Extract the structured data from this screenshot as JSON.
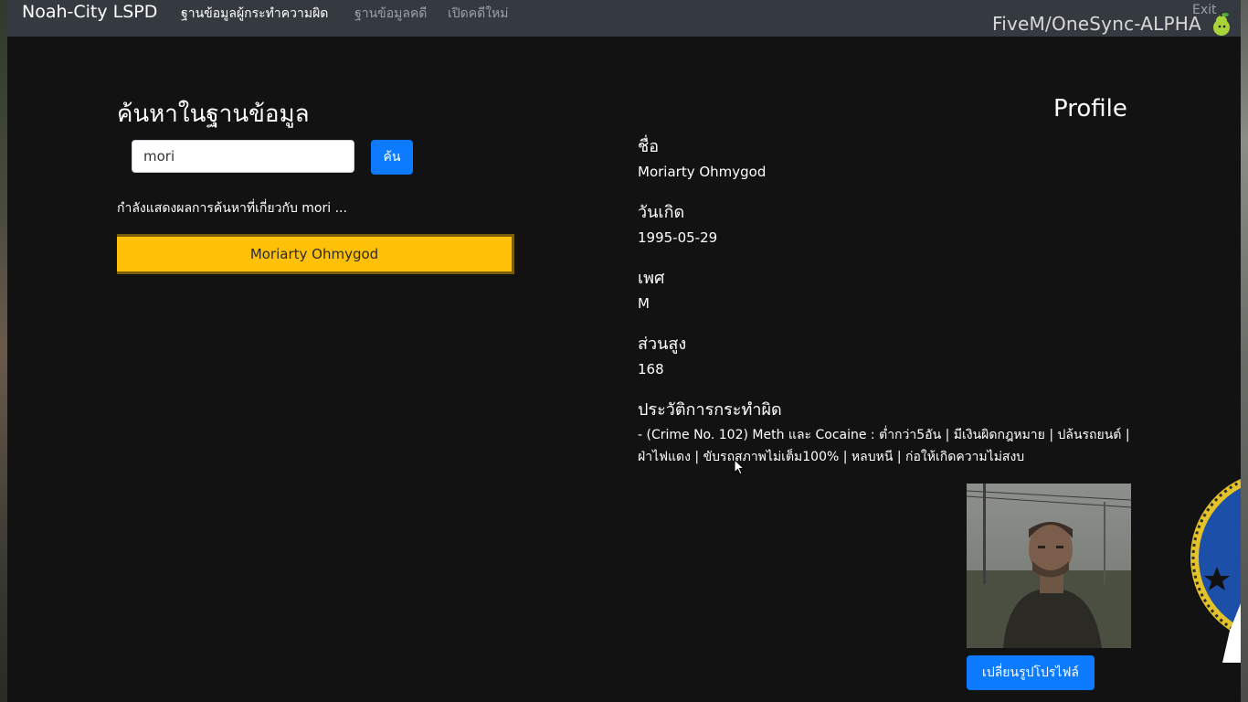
{
  "navbar": {
    "brand": "Noah-City LSPD",
    "links": [
      {
        "label": "ฐานข้อมูลผู้กระทำความผิด",
        "active": true
      },
      {
        "label": "ฐานข้อมูลคดี",
        "active": false
      },
      {
        "label": "เปิดคดีใหม่",
        "active": false
      }
    ],
    "exit_label": "Exit"
  },
  "overlay": {
    "server_label": "FiveM/OneSync-ALPHA"
  },
  "search": {
    "title": "ค้นหาในฐานข้อมูล",
    "query": "mori",
    "button_label": "ค้น",
    "result_caption": "กำลังแสดงผลการค้นหาที่เกี่ยวกับ mori ...",
    "results": [
      "Moriarty Ohmygod"
    ]
  },
  "profile": {
    "title": "Profile",
    "name_label": "ชื่อ",
    "name": "Moriarty Ohmygod",
    "dob_label": "วันเกิด",
    "dob": "1995-05-29",
    "sex_label": "เพศ",
    "sex": "M",
    "height_label": "ส่วนสูง",
    "height": "168",
    "record_label": "ประวัติการกระทำผิด",
    "record": "- (Crime No. 102) Meth และ Cocaine : ต่ำกว่า5อัน | มีเงินผิดกฎหมาย | ปล้นรถยนต์ | ฝ่าไฟแดง | ขับรถสภาพไม่เต็ม100% | หลบหนี | ก่อให้เกิดความไม่สงบ",
    "change_photo_label": "เปลี่ยนรูปโปรไฟล์"
  },
  "colors": {
    "background": "#121212",
    "navbar": "#353a40",
    "primary": "#0d7bff",
    "result_highlight": "#ffc107"
  }
}
